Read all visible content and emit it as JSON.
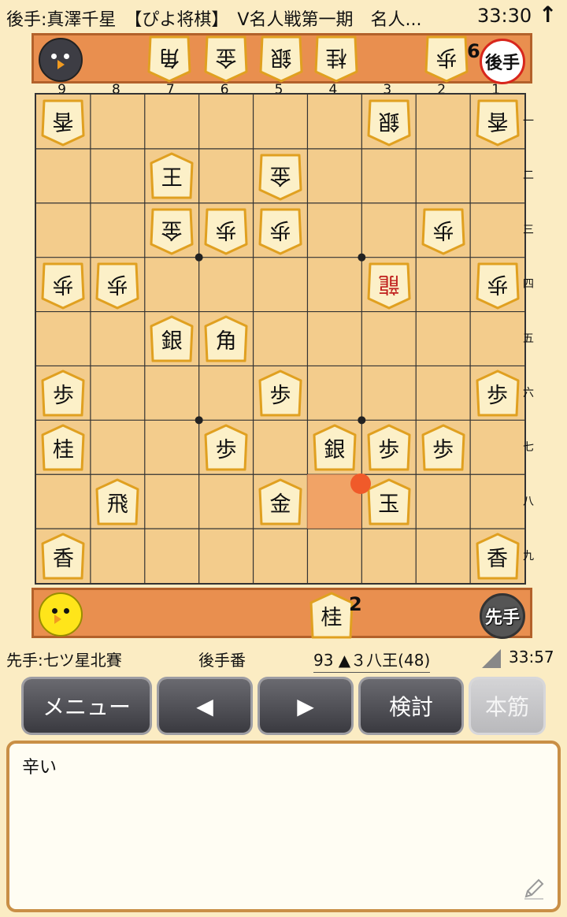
{
  "header": {
    "title": "後手:真澤千星　【ぴよ将棋】　V名人戦第一期　名人...",
    "time": "33:30",
    "upload_icon": "up-arrow-icon"
  },
  "gote": {
    "badge": "後手",
    "hand": [
      {
        "kanji": "歩",
        "count": "6"
      },
      {
        "kanji": "桂",
        "count": ""
      },
      {
        "kanji": "銀",
        "count": ""
      },
      {
        "kanji": "金",
        "count": ""
      },
      {
        "kanji": "角",
        "count": ""
      }
    ]
  },
  "sente": {
    "badge": "先手",
    "hand": [
      {
        "kanji": "桂",
        "count": "2"
      }
    ]
  },
  "board": {
    "col_labels": [
      "9",
      "8",
      "7",
      "6",
      "5",
      "4",
      "3",
      "2",
      "1"
    ],
    "row_labels": [
      "一",
      "二",
      "三",
      "四",
      "五",
      "六",
      "七",
      "八",
      "九"
    ],
    "pieces": [
      {
        "kanji": "香",
        "owner": "gote",
        "file": 9,
        "rank": 1
      },
      {
        "kanji": "銀",
        "owner": "gote",
        "file": 3,
        "rank": 1
      },
      {
        "kanji": "香",
        "owner": "gote",
        "file": 1,
        "rank": 1
      },
      {
        "kanji": "王",
        "owner": "sente",
        "file": 7,
        "rank": 2
      },
      {
        "kanji": "金",
        "owner": "gote",
        "file": 5,
        "rank": 2
      },
      {
        "kanji": "金",
        "owner": "gote",
        "file": 7,
        "rank": 3
      },
      {
        "kanji": "歩",
        "owner": "gote",
        "file": 6,
        "rank": 3
      },
      {
        "kanji": "歩",
        "owner": "gote",
        "file": 5,
        "rank": 3
      },
      {
        "kanji": "歩",
        "owner": "gote",
        "file": 2,
        "rank": 3
      },
      {
        "kanji": "歩",
        "owner": "gote",
        "file": 9,
        "rank": 4
      },
      {
        "kanji": "歩",
        "owner": "gote",
        "file": 8,
        "rank": 4
      },
      {
        "kanji": "龍",
        "owner": "gote",
        "file": 3,
        "rank": 4,
        "promoted": true
      },
      {
        "kanji": "歩",
        "owner": "gote",
        "file": 1,
        "rank": 4
      },
      {
        "kanji": "銀",
        "owner": "sente",
        "file": 7,
        "rank": 5
      },
      {
        "kanji": "角",
        "owner": "sente",
        "file": 6,
        "rank": 5
      },
      {
        "kanji": "歩",
        "owner": "sente",
        "file": 9,
        "rank": 6
      },
      {
        "kanji": "歩",
        "owner": "sente",
        "file": 5,
        "rank": 6
      },
      {
        "kanji": "歩",
        "owner": "sente",
        "file": 1,
        "rank": 6
      },
      {
        "kanji": "桂",
        "owner": "sente",
        "file": 9,
        "rank": 7
      },
      {
        "kanji": "歩",
        "owner": "sente",
        "file": 6,
        "rank": 7
      },
      {
        "kanji": "銀",
        "owner": "sente",
        "file": 4,
        "rank": 7
      },
      {
        "kanji": "歩",
        "owner": "sente",
        "file": 3,
        "rank": 7
      },
      {
        "kanji": "歩",
        "owner": "sente",
        "file": 2,
        "rank": 7
      },
      {
        "kanji": "飛",
        "owner": "sente",
        "file": 8,
        "rank": 8
      },
      {
        "kanji": "金",
        "owner": "sente",
        "file": 5,
        "rank": 8
      },
      {
        "kanji": "玉",
        "owner": "sente",
        "file": 3,
        "rank": 8
      },
      {
        "kanji": "香",
        "owner": "sente",
        "file": 9,
        "rank": 9
      },
      {
        "kanji": "香",
        "owner": "sente",
        "file": 1,
        "rank": 9
      }
    ],
    "highlight": {
      "file": 4,
      "rank": 8
    },
    "last_move_marker": {
      "file": 3,
      "rank": 8
    }
  },
  "status": {
    "sente_name": "先手:七ツ星北賽",
    "turn": "後手番",
    "move": "93 ▲３八王(48)",
    "time": "33:57"
  },
  "buttons": {
    "menu": "メニュー",
    "prev": "◀",
    "next": "▶",
    "review": "検討",
    "mainline": "本筋"
  },
  "comment": {
    "text": "辛い",
    "edit_icon": "pencil-icon"
  },
  "colors": {
    "background": "#fbecc3",
    "board": "#f3cc8c",
    "stand": "#e98f4f",
    "highlight": "#f0955a",
    "promoted_text": "#c0211f"
  }
}
